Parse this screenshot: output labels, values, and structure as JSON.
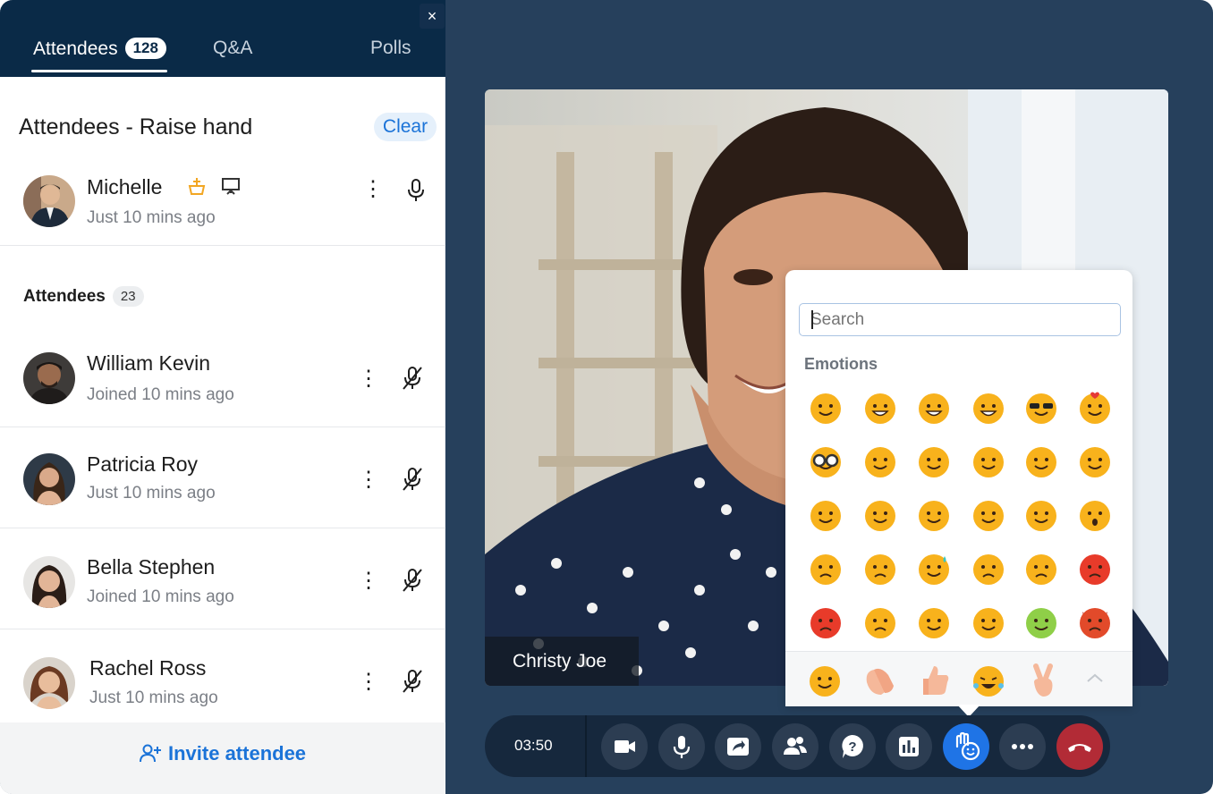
{
  "sidebar": {
    "tabs": [
      {
        "label": "Attendees",
        "count": "128"
      },
      {
        "label": "Q&A"
      },
      {
        "label": "Polls"
      }
    ],
    "close_label": "×",
    "raise_hand": {
      "title": "Attendees - Raise hand",
      "clear_label": "Clear",
      "person": {
        "name": "Michelle",
        "time": "Just 10 mins ago"
      }
    },
    "attendees": {
      "title": "Attendees",
      "count": "23",
      "list": [
        {
          "name": "William Kevin",
          "time": "Joined 10 mins ago"
        },
        {
          "name": "Patricia Roy",
          "time": "Just 10 mins ago"
        },
        {
          "name": "Bella Stephen",
          "time": "Joined 10 mins ago"
        },
        {
          "name": "Rachel Ross",
          "time": "Just 10 mins ago"
        }
      ]
    },
    "invite_label": "Invite attendee"
  },
  "video": {
    "speaker_name": "Christy Joe"
  },
  "emoji_panel": {
    "search_placeholder": "Search",
    "section_label": "Emotions"
  },
  "toolbar": {
    "timer": "03:50",
    "buttons": [
      "camera-icon",
      "mic-icon",
      "share-screen-icon",
      "participants-icon",
      "question-icon",
      "polls-icon",
      "reactions-icon",
      "more-icon",
      "end-call-icon"
    ]
  },
  "colors": {
    "sidebar_header": "#0a2a47",
    "accent": "#1b73d8",
    "background": "#26405c",
    "end_call": "#b22b36",
    "emoji_yellow": "#f8b21c"
  }
}
